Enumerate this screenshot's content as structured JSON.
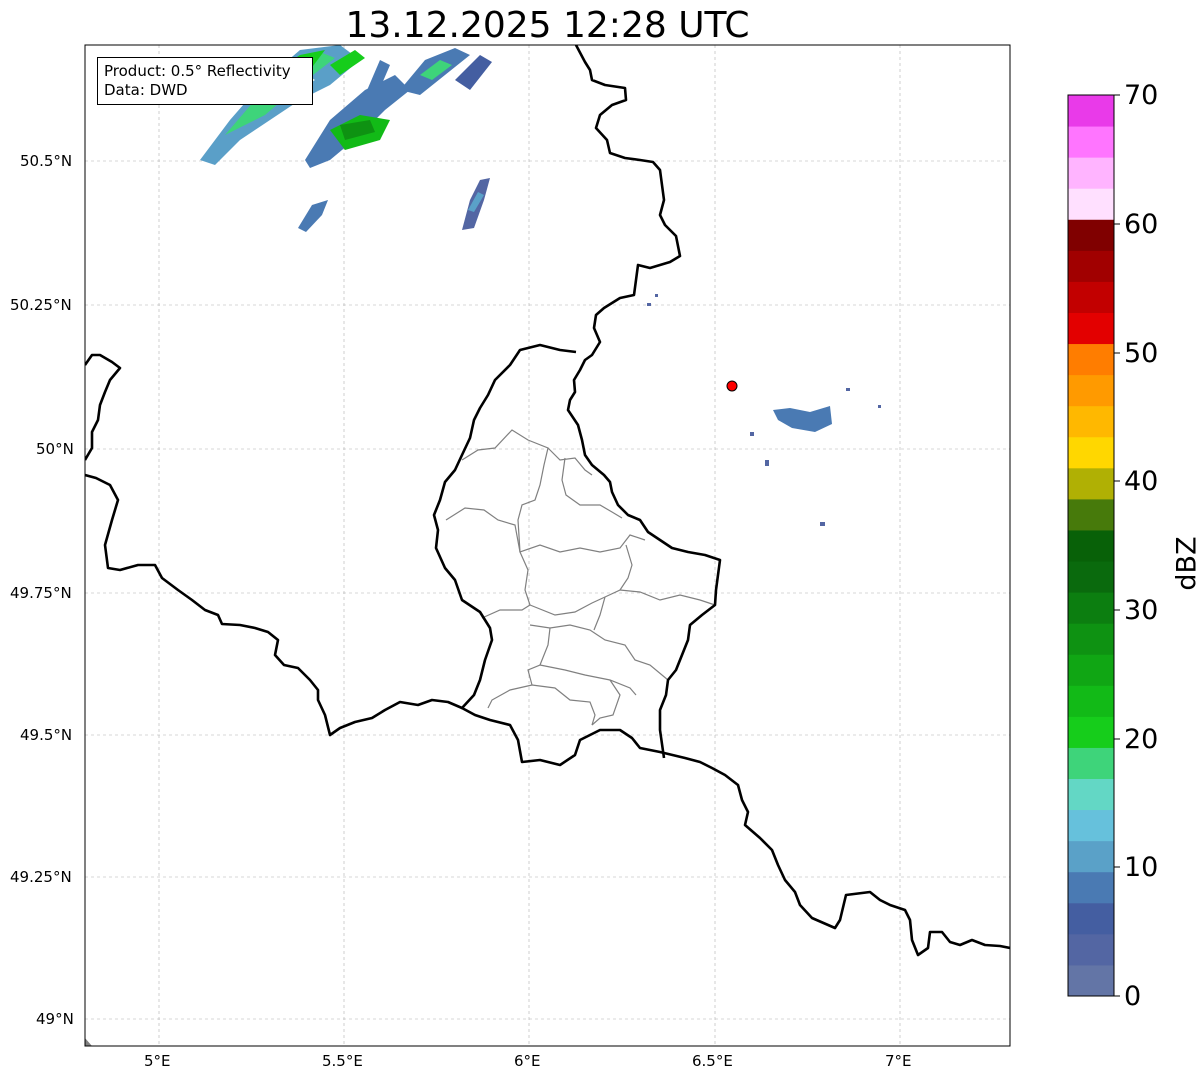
{
  "title": "13.12.2025 12:28 UTC",
  "info": {
    "product": "Product: 0.5° Reflectivity",
    "source": "Data: DWD"
  },
  "axes": {
    "lon_ticks": [
      "5°E",
      "5.5°E",
      "6°E",
      "6.5°E",
      "7°E"
    ],
    "lat_ticks": [
      "50.5°N",
      "50.25°N",
      "50°N",
      "49.75°N",
      "49.5°N",
      "49.25°N",
      "49°N"
    ]
  },
  "colorbar": {
    "label": "dBZ",
    "ticks": [
      "70",
      "60",
      "50",
      "40",
      "30",
      "20",
      "10",
      "0"
    ],
    "colors": [
      "#6375a6",
      "#5366a3",
      "#445ea1",
      "#4a7ab3",
      "#5aa1c8",
      "#66c1dc",
      "#63d7c5",
      "#3ed47a",
      "#16cd1b",
      "#12ba17",
      "#10a614",
      "#0e9212",
      "#0c7e10",
      "#0a6a0d",
      "#086108",
      "#477a0b",
      "#b0b004",
      "#ffd700",
      "#ffb800",
      "#ff9a00",
      "#ff7d00",
      "#e30000",
      "#c20000",
      "#a10000",
      "#800000",
      "#ffe0ff",
      "#ffb4ff",
      "#ff75ff",
      "#e93ae9"
    ]
  },
  "colors": {
    "border": "#000000",
    "districts": "#808080",
    "grid": "#b0b0b0",
    "radar_site": "#ff0000"
  },
  "radar_site": "radar-site-marker"
}
